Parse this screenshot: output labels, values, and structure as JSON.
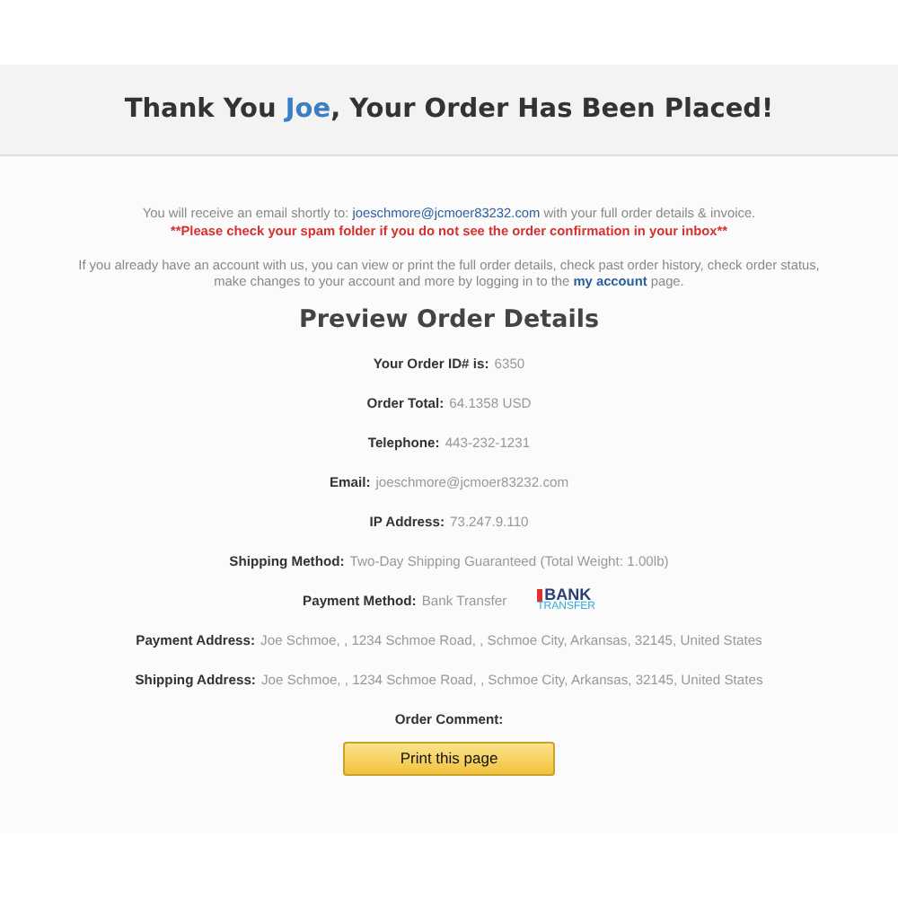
{
  "header": {
    "title_before": "Thank You ",
    "name": "Joe",
    "title_after": ", Your Order Has Been Placed!"
  },
  "notice": {
    "before": "You will receive an email shortly to: ",
    "email": "joeschmore@jcmoer83232.com",
    "after": " with your full order details & invoice.",
    "warning": "**Please check your spam folder if you do not see the order confirmation in your inbox**"
  },
  "account_note": {
    "before": "If you already have an account with us, you can view or print the full order details, check past order history, check order status, make changes to your account and more by logging in to the ",
    "link": "my account",
    "after": " page."
  },
  "details_title": "Preview Order Details",
  "details": [
    {
      "label": "Your Order ID# is:",
      "value": "6350"
    },
    {
      "label": "Order Total:",
      "value": "64.1358 USD"
    },
    {
      "label": "Telephone:",
      "value": "443-232-1231"
    },
    {
      "label": "Email:",
      "value": "joeschmore@jcmoer83232.com"
    },
    {
      "label": "IP Address:",
      "value": "73.247.9.110"
    },
    {
      "label": "Shipping Method:",
      "value": "Two-Day Shipping Guaranteed (Total Weight: 1.00lb)"
    },
    {
      "label": "Payment Method:",
      "value": "Bank Transfer",
      "logo": {
        "line1": "BANK",
        "line2": "TRANSFER"
      }
    },
    {
      "label": "Payment Address:",
      "value": "Joe Schmoe, , 1234 Schmoe Road, , Schmoe City, Arkansas, 32145, United States"
    },
    {
      "label": "Shipping Address:",
      "value": "Joe Schmoe, , 1234 Schmoe Road, , Schmoe City, Arkansas, 32145, United States"
    },
    {
      "label": "Order Comment:"
    }
  ],
  "print_button": "Print this page"
}
